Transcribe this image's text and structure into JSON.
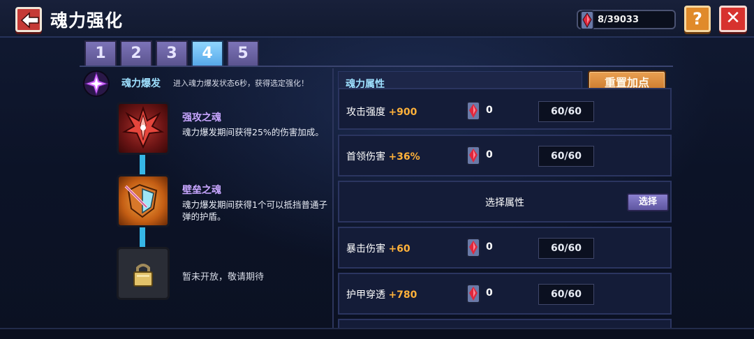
{
  "header": {
    "title": "魂力强化",
    "currency": "8/39033",
    "help_label": "?",
    "close_label": "✕"
  },
  "tabs": [
    {
      "label": "1",
      "active": false
    },
    {
      "label": "2",
      "active": false
    },
    {
      "label": "3",
      "active": false
    },
    {
      "label": "4",
      "active": true
    },
    {
      "label": "5",
      "active": false
    }
  ],
  "burst": {
    "title": "魂力爆发",
    "description": "进入魂力爆发状态6秒，获得选定强化！"
  },
  "souls": [
    {
      "name": "强攻之魂",
      "description": "魂力爆发期间获得25%的伤害加成。",
      "icon": "red-crest-icon"
    },
    {
      "name": "壁垒之魂",
      "description": "魂力爆发期间获得1个可以抵挡普通子弹的护盾。",
      "icon": "shield-icon"
    },
    {
      "name": "",
      "description": "暂未开放，敬请期待",
      "icon": "lock-icon"
    }
  ],
  "attributes_panel": {
    "header": "魂力属性",
    "reset_label": "重置加点"
  },
  "attributes": [
    {
      "name": "攻击强度",
      "bonus": "+900",
      "cost": "0",
      "level": "60/60"
    },
    {
      "name": "首领伤害",
      "bonus": "+36%",
      "cost": "0",
      "level": "60/60"
    },
    {
      "select_label": "选择属性",
      "button_label": "选择"
    },
    {
      "name": "暴击伤害",
      "bonus": "+60",
      "cost": "0",
      "level": "60/60"
    },
    {
      "name": "护甲穿透",
      "bonus": "+780",
      "cost": "0",
      "level": "60/60"
    }
  ],
  "colors": {
    "accent_cyan": "#9ee0ff",
    "bonus_orange": "#ffb13a",
    "soul_name_purple": "#c8a6ff",
    "tab_active": "#57a8e8"
  }
}
